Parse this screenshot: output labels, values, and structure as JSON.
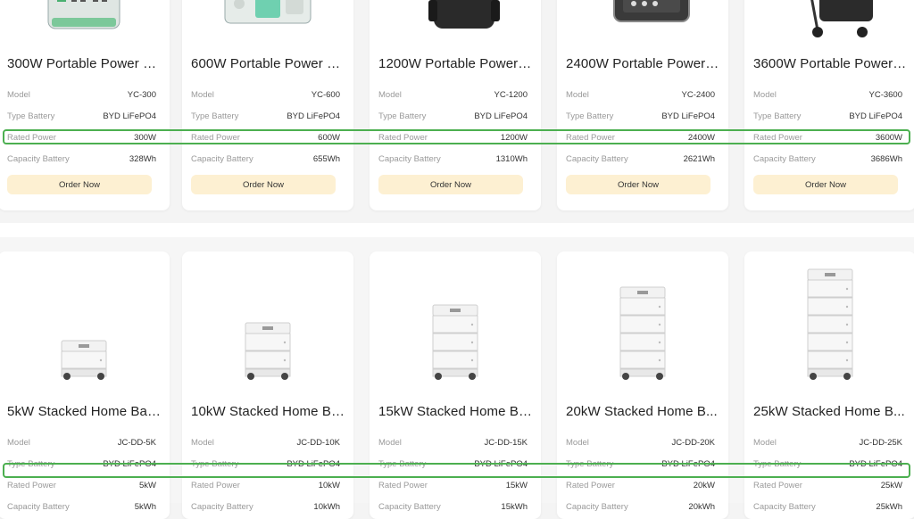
{
  "labels": {
    "model": "Model",
    "type_battery": "Type Battery",
    "rated_power": "Rated Power",
    "capacity_battery": "Capacity Battery",
    "order_now": "Order Now"
  },
  "colors": {
    "highlight": "#4caf50",
    "order_button_bg": "#fdf0d2"
  },
  "portable": [
    {
      "title": "300W Portable Power S...",
      "model": "YC-300",
      "type": "BYD LiFePO4",
      "power": "300W",
      "capacity": "328Wh",
      "image": "portable-station-image"
    },
    {
      "title": "600W Portable Power S...",
      "model": "YC-600",
      "type": "BYD LiFePO4",
      "power": "600W",
      "capacity": "655Wh",
      "image": "portable-station-image"
    },
    {
      "title": "1200W Portable Power ...",
      "model": "YC-1200",
      "type": "BYD LiFePO4",
      "power": "1200W",
      "capacity": "1310Wh",
      "image": "portable-station-image"
    },
    {
      "title": "2400W Portable Power ...",
      "model": "YC-2400",
      "type": "BYD LiFePO4",
      "power": "2400W",
      "capacity": "2621Wh",
      "image": "portable-station-image"
    },
    {
      "title": "3600W Portable Power ...",
      "model": "YC-3600",
      "type": "BYD LiFePO4",
      "power": "3600W",
      "capacity": "3686Wh",
      "image": "portable-station-with-wheels-image"
    }
  ],
  "stacked": [
    {
      "title": "5kW Stacked Home Bat...",
      "model": "JC-DD-5K",
      "type": "BYD LiFePO4",
      "power": "5kW",
      "capacity": "5kWh",
      "modules": 1
    },
    {
      "title": "10kW Stacked Home Ba...",
      "model": "JC-DD-10K",
      "type": "BYD LiFePO4",
      "power": "10kW",
      "capacity": "10kWh",
      "modules": 2
    },
    {
      "title": "15kW Stacked Home Ba...",
      "model": "JC-DD-15K",
      "type": "BYD LiFePO4",
      "power": "15kW",
      "capacity": "15kWh",
      "modules": 3
    },
    {
      "title": "20kW Stacked Home B...",
      "model": "JC-DD-20K",
      "type": "BYD LiFePO4",
      "power": "20kW",
      "capacity": "20kWh",
      "modules": 4
    },
    {
      "title": "25kW Stacked Home B...",
      "model": "JC-DD-25K",
      "type": "BYD LiFePO4",
      "power": "25kW",
      "capacity": "25kWh",
      "modules": 5
    }
  ]
}
